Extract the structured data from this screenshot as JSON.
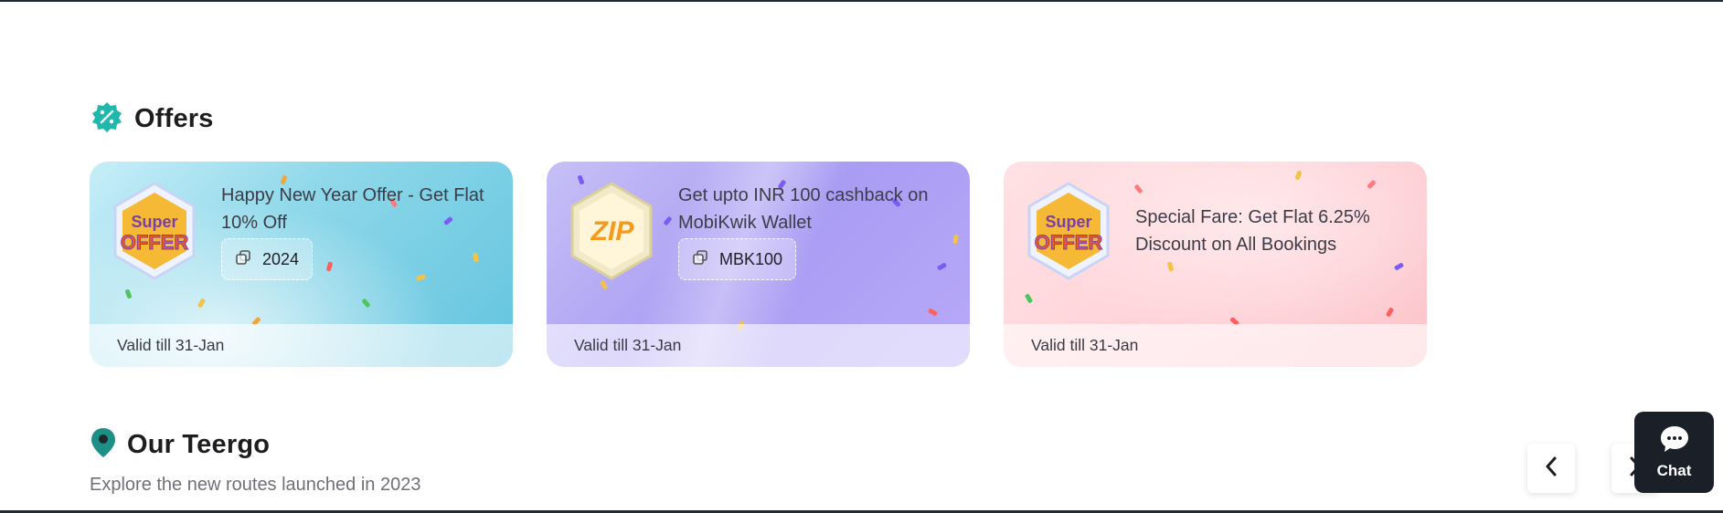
{
  "offers": {
    "title": "Offers",
    "icon": "discount-badge-icon",
    "accent": "#20b2aa",
    "cards": [
      {
        "title": "Happy New Year Offer - Get Flat 10% Off",
        "coupon": "2024",
        "valid": "Valid till 31-Jan",
        "badge": "super-offer-badge",
        "badge_text": [
          "Super",
          "OFFER"
        ]
      },
      {
        "title": "Get upto INR 100 cashback on MobiKwik Wallet",
        "coupon": "MBK100",
        "valid": "Valid till 31-Jan",
        "badge": "zip-badge",
        "badge_text": [
          "ZIP"
        ]
      },
      {
        "title": "Special Fare: Get Flat 6.25% Discount on All Bookings",
        "valid": "Valid till 31-Jan",
        "badge": "super-offer-badge",
        "badge_text": [
          "Super",
          "OFFER"
        ]
      }
    ]
  },
  "teergo": {
    "title": "Our Teergo",
    "icon": "location-pin-icon",
    "subtitle": "Explore the new routes launched in 2023"
  },
  "nav": {
    "prev_icon": "chevron-left-icon",
    "next_icon": "chevron-right-icon"
  },
  "chat": {
    "label": "Chat",
    "icon": "chat-bubble-icon"
  }
}
